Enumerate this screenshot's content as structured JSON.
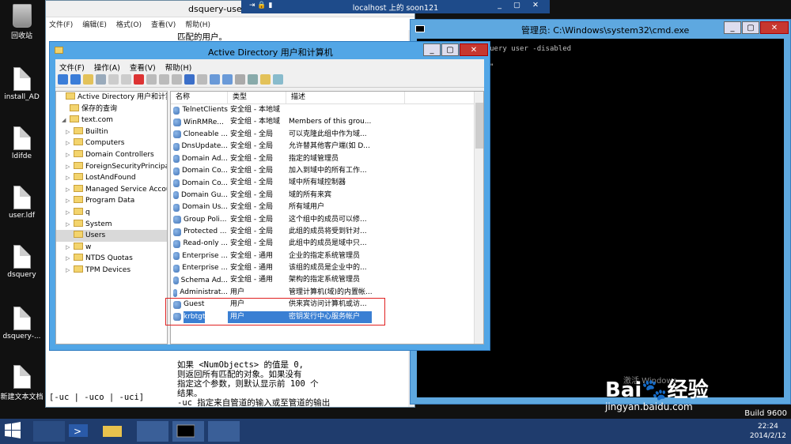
{
  "desktop": {
    "icons": [
      "回收站",
      "install_AD",
      "ldifde",
      "user.ldf",
      "dsquery",
      "dsquery-...",
      "新建文本文档"
    ]
  },
  "notepad": {
    "title": "dsquery-use",
    "menu": [
      "文件(F)",
      "编辑(E)",
      "格式(O)",
      "查看(V)",
      "帮助(H)"
    ],
    "top_lines": [
      "匹配的用户。"
    ],
    "bottom_lines": [
      "如果 <NumObjects> 的值是 0,",
      "则返回所有匹配的对象。如果没有",
      "指定这个参数，则默认显示前 100 个",
      "结果。",
      "-uc 指定来自管道的输入或至管道的输出"
    ],
    "left_col": "[-uc | -uco | -uci]"
  },
  "remote": {
    "title": "localhost 上的 soon121"
  },
  "cmd": {
    "title": "管理员: C:\\Windows\\system32\\cmd.exe",
    "lines": [
      "rator\\Desktop>dsquery user -disabled",
      "s,DC=text,DC=com\"",
      "rs,DC=text,DC=com\"",
      "",
      "rator\\Desktop>"
    ]
  },
  "aduc": {
    "title": "Active Directory 用户和计算机",
    "menu": [
      "文件(F)",
      "操作(A)",
      "查看(V)",
      "帮助(H)"
    ],
    "tree": [
      {
        "label": "Active Directory 用户和计算机 [s",
        "indent": 0,
        "arrow": ""
      },
      {
        "label": "保存的查询",
        "indent": 1,
        "arrow": ""
      },
      {
        "label": "text.com",
        "indent": 1,
        "arrow": "◢"
      },
      {
        "label": "Builtin",
        "indent": 2,
        "arrow": "▷"
      },
      {
        "label": "Computers",
        "indent": 2,
        "arrow": "▷"
      },
      {
        "label": "Domain Controllers",
        "indent": 2,
        "arrow": "▷"
      },
      {
        "label": "ForeignSecurityPrincipals",
        "indent": 2,
        "arrow": "▷"
      },
      {
        "label": "LostAndFound",
        "indent": 2,
        "arrow": "▷"
      },
      {
        "label": "Managed Service Accour",
        "indent": 2,
        "arrow": "▷"
      },
      {
        "label": "Program Data",
        "indent": 2,
        "arrow": "▷"
      },
      {
        "label": "q",
        "indent": 2,
        "arrow": "▷"
      },
      {
        "label": "System",
        "indent": 2,
        "arrow": "▷"
      },
      {
        "label": "Users",
        "indent": 2,
        "arrow": ""
      },
      {
        "label": "w",
        "indent": 2,
        "arrow": "▷"
      },
      {
        "label": "NTDS Quotas",
        "indent": 2,
        "arrow": "▷"
      },
      {
        "label": "TPM Devices",
        "indent": 2,
        "arrow": "▷"
      }
    ],
    "columns": [
      "名称",
      "类型",
      "描述"
    ],
    "rows": [
      [
        "TelnetClients",
        "安全组 - 本地域",
        ""
      ],
      [
        "WinRMRe...",
        "安全组 - 本地域",
        "Members of this grou..."
      ],
      [
        "Cloneable ...",
        "安全组 - 全局",
        "可以克隆此组中作为域..."
      ],
      [
        "DnsUpdate...",
        "安全组 - 全局",
        "允许替其他客户端(如 D..."
      ],
      [
        "Domain Ad...",
        "安全组 - 全局",
        "指定的域管理员"
      ],
      [
        "Domain Co...",
        "安全组 - 全局",
        "加入到域中的所有工作..."
      ],
      [
        "Domain Co...",
        "安全组 - 全局",
        "域中所有域控制器"
      ],
      [
        "Domain Gu...",
        "安全组 - 全局",
        "域的所有来宾"
      ],
      [
        "Domain Us...",
        "安全组 - 全局",
        "所有域用户"
      ],
      [
        "Group Poli...",
        "安全组 - 全局",
        "这个组中的成员可以修..."
      ],
      [
        "Protected ...",
        "安全组 - 全局",
        "此组的成员将受到针对..."
      ],
      [
        "Read-only ...",
        "安全组 - 全局",
        "此组中的成员是域中只..."
      ],
      [
        "Enterprise ...",
        "安全组 - 通用",
        "企业的指定系统管理员"
      ],
      [
        "Enterprise ...",
        "安全组 - 通用",
        "该组的成员是企业中的..."
      ],
      [
        "Schema Ad...",
        "安全组 - 通用",
        "架构的指定系统管理员"
      ],
      [
        "Administrat...",
        "用户",
        "管理计算机(域)的内置帐..."
      ],
      [
        "Guest",
        "用户",
        "供来宾访问计算机或访..."
      ],
      [
        "krbtgt",
        "用户",
        "密钥发行中心服务帐户"
      ]
    ]
  },
  "watermark": {
    "brand": "Bai",
    "brand2": "经验",
    "url": "jingyan.baidu.com"
  },
  "activate": "激活 Windows",
  "build": "Build 9600",
  "clock": {
    "time": "22:24",
    "date": "2014/2/12"
  }
}
